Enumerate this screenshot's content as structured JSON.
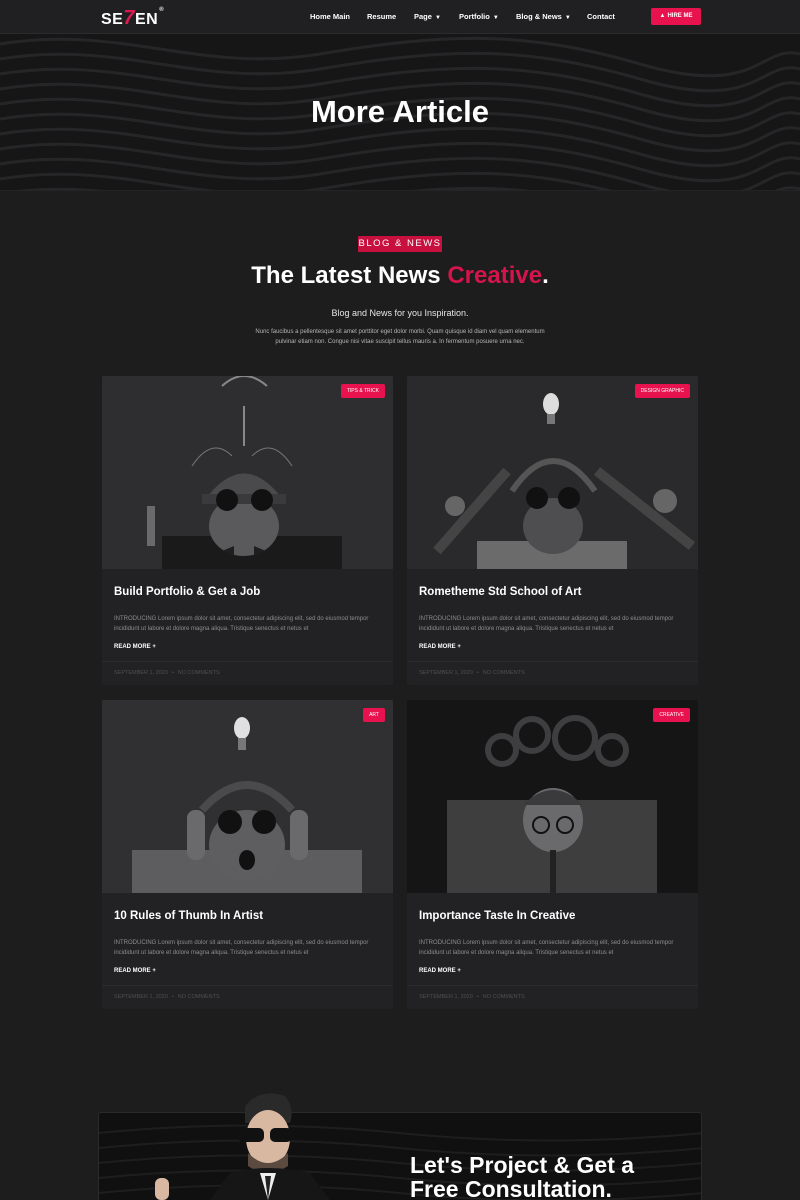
{
  "navbar": {
    "logo": {
      "prefix": "SE",
      "seven": "7",
      "suffix": "EN",
      "mark": "®"
    },
    "items": [
      {
        "label": "Home Main",
        "has_dropdown": false
      },
      {
        "label": "Resume",
        "has_dropdown": false
      },
      {
        "label": "Page",
        "has_dropdown": true
      },
      {
        "label": "Portfolio",
        "has_dropdown": true
      },
      {
        "label": "Blog & News",
        "has_dropdown": true
      },
      {
        "label": "Contact",
        "has_dropdown": false
      }
    ],
    "dropdown_icon": "caret-down-icon",
    "hire_button": {
      "label": "HIRE ME",
      "icon": "fire-icon"
    }
  },
  "hero": {
    "title": "More Article"
  },
  "section": {
    "tag": "BLOG & NEWS",
    "title_main": "The Latest News",
    "title_accent": "Creative",
    "title_period": ".",
    "subtitle": "Blog and News for you Inspiration.",
    "description": "Nunc faucibus a pellentesque sit amet porttitor eget dolor morbi. Quam quisque id diam vel quam elementum pulvinar etiam non. Congue nisi vitae suscipit tellus mauris a. In fermentum posuere urna nec."
  },
  "posts": [
    {
      "category": "TIPS & TRICK",
      "title": "Build Portfolio & Get a Job",
      "excerpt": "INTRODUCING Lorem ipsum dolor sit amet, consectetur adipiscing elit, sed do eiusmod tempor incididunt ut labore et dolore magna aliqua. Tristique senectus et netus et",
      "read_more": "READ MORE +",
      "date": "SEPTEMBER 1, 2020",
      "comments": "NO COMMENTS"
    },
    {
      "category": "DESIGN GRAPHIC",
      "title": "Rometheme Std School of Art",
      "excerpt": "INTRODUCING Lorem ipsum dolor sit amet, consectetur adipiscing elit, sed do eiusmod tempor incididunt ut labore et dolore magna aliqua. Tristique senectus et netus et",
      "read_more": "READ MORE +",
      "date": "SEPTEMBER 1, 2020",
      "comments": "NO COMMENTS"
    },
    {
      "category": "ART",
      "title": "10 Rules of Thumb In Artist",
      "excerpt": "INTRODUCING Lorem ipsum dolor sit amet, consectetur adipiscing elit, sed do eiusmod tempor incididunt ut labore et dolore magna aliqua. Tristique senectus et netus et",
      "read_more": "READ MORE +",
      "date": "SEPTEMBER 1, 2020",
      "comments": "NO COMMENTS"
    },
    {
      "category": "CREATIVE",
      "title": "Importance Taste In Creative",
      "excerpt": "INTRODUCING Lorem ipsum dolor sit amet, consectetur adipiscing elit, sed do eiusmod tempor incididunt ut labore et dolore magna aliqua. Tristique senectus et netus et",
      "read_more": "READ MORE +",
      "date": "SEPTEMBER 1, 2020",
      "comments": "NO COMMENTS"
    }
  ],
  "cta": {
    "line1": "Let's Project & Get a",
    "line2": "Free Consultation."
  },
  "colors": {
    "accent": "#e8134e",
    "background": "#1d1d1e",
    "card": "#222224"
  }
}
